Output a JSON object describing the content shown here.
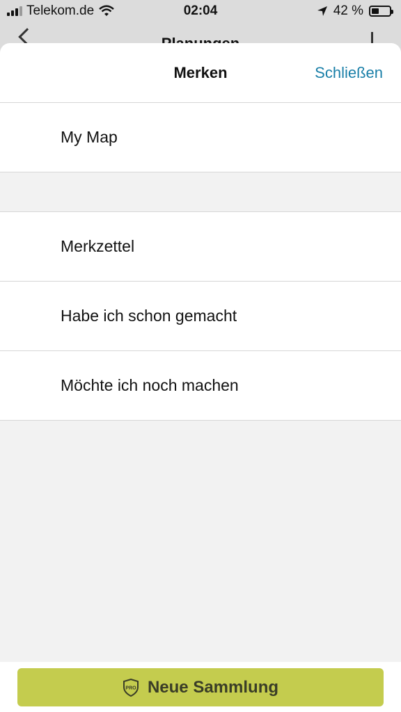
{
  "status_bar": {
    "carrier": "Telekom.de",
    "time": "02:04",
    "battery_percent": "42 %",
    "battery_level": 0.42,
    "icons": [
      "cellular-signal-icon",
      "wifi-icon",
      "location-arrow-icon",
      "battery-icon"
    ]
  },
  "background": {
    "title": "Planungen"
  },
  "sheet": {
    "title": "Merken",
    "close_label": "Schließen",
    "section1": [
      {
        "label": "My Map"
      }
    ],
    "section2": [
      {
        "label": "Merkzettel"
      },
      {
        "label": "Habe ich schon gemacht"
      },
      {
        "label": "Möchte ich noch machen"
      }
    ]
  },
  "bottom": {
    "button_label": "Neue Sammlung",
    "button_icon": "pro-badge-icon",
    "icon_text": "PRO",
    "accent_color": "#c4cc4e"
  },
  "colors": {
    "link": "#1a7fa8",
    "background": "#f2f2f2"
  }
}
